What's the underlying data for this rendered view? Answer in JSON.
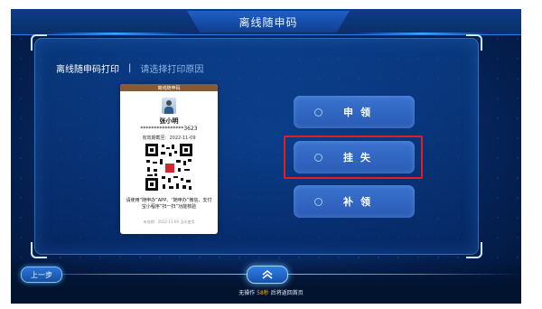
{
  "header": {
    "title": "离线随申码"
  },
  "breadcrumb": {
    "current": "离线随申码打印",
    "separator": "|",
    "hint": "请选择打印原因"
  },
  "card": {
    "header": "离线随申码",
    "name": "张小明",
    "id_number": "****************3623",
    "validity": "有效期截至：2022-11-09",
    "tip": "请使用“随申办”APP、“随申办”微信、支付宝小程序“扫一扫”功能核验",
    "footer": "有效期：2022-11-09 当天使用"
  },
  "actions": [
    {
      "label": "申领"
    },
    {
      "label": "挂失"
    },
    {
      "label": "补领"
    }
  ],
  "footer": {
    "back_label": "上一步",
    "home_icon": "home-icon",
    "timeout_prefix": "无操作",
    "timeout_seconds": "58秒",
    "timeout_suffix": "后将返回首页"
  },
  "colors": {
    "accent": "#2a5bb4",
    "highlight": "#e0201c",
    "countdown": "#ffb400"
  }
}
